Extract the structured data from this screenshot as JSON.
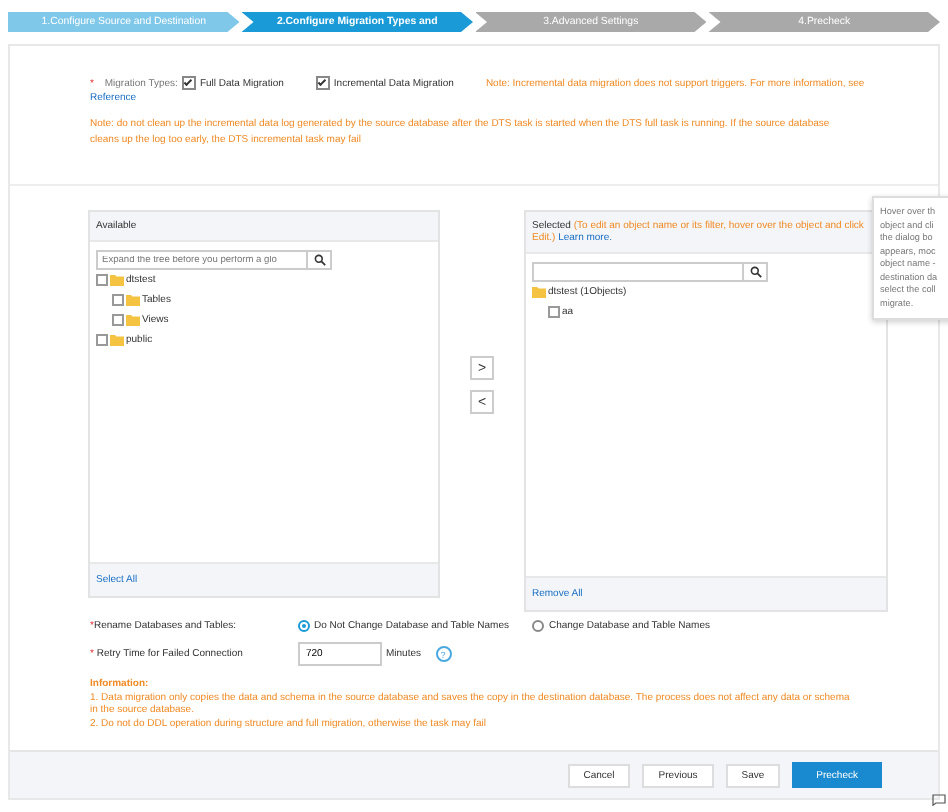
{
  "steps": [
    {
      "label": "1.Configure Source and Destination",
      "completed": true,
      "selected": false
    },
    {
      "label": "2.Configure Migration Types and",
      "completed": false,
      "selected": true
    },
    {
      "label": "3.Advanced Settings",
      "completed": false,
      "selected": false
    },
    {
      "label": "4.Precheck",
      "completed": false,
      "selected": false
    }
  ],
  "migration_types": {
    "required_mark": "*",
    "label": "Migration Types:",
    "options": [
      {
        "label": "Full Data Migration",
        "checked": true
      },
      {
        "label": "Incremental Data Migration",
        "checked": true
      }
    ],
    "note": "Note: Incremental data migration does not support triggers. For more information, see",
    "link": "Reference"
  },
  "log_note": "Note: do not clean up the incremental data log generated by the source database after the DTS task is started when the DTS full task is running. If the source database cleans up the log too early, the DTS incremental task may fail",
  "available": {
    "title": "Available",
    "search_placeholder": "Expand the tree before you perform a glo",
    "tree": [
      {
        "label": "dtstest",
        "checked": false,
        "children": [
          {
            "label": "Tables",
            "checked": false
          },
          {
            "label": "Views",
            "checked": false
          }
        ]
      },
      {
        "label": "public",
        "checked": false
      }
    ],
    "footer_link": "Select All"
  },
  "move_buttons": [
    ">",
    "<"
  ],
  "selected_panel": {
    "title": "Selected",
    "hint": "(To edit an object name or its filter, hover over the object and click",
    "hint_end": "Edit.)",
    "learn_more": "Learn more.",
    "tree": [
      {
        "label": "dtstest (1Objects)",
        "children": [
          {
            "label": "aa",
            "checked": false
          }
        ]
      }
    ],
    "footer_link": "Remove All"
  },
  "tooltip": {
    "lines": [
      "Hover over th",
      "object and cli",
      "the dialog bo",
      "appears, moc",
      "object name -",
      "destination da",
      "select the coll",
      "migrate."
    ]
  },
  "rename": {
    "required_mark": "*",
    "label": "Rename Databases and Tables:",
    "options": [
      {
        "label": "Do Not Change Database and Table Names",
        "selected": true
      },
      {
        "label": "Change Database and Table Names",
        "selected": false
      }
    ]
  },
  "retry": {
    "required_mark": "*",
    "label": "Retry Time for Failed Connection",
    "value": "720",
    "unit": "Minutes",
    "help": "?"
  },
  "information": {
    "title": "Information:",
    "lines": [
      "1. Data migration only copies the data and schema in the source database and saves the copy in the destination database. The process does not affect any data or schema in the source database.",
      "2. Do not do DDL operation during structure and full migration, otherwise the task may fail"
    ]
  },
  "buttons": [
    {
      "label": "Cancel",
      "kind": "default"
    },
    {
      "label": "Previous",
      "kind": "default"
    },
    {
      "label": "Save",
      "kind": "default"
    },
    {
      "label": "Precheck",
      "kind": "primary"
    }
  ]
}
